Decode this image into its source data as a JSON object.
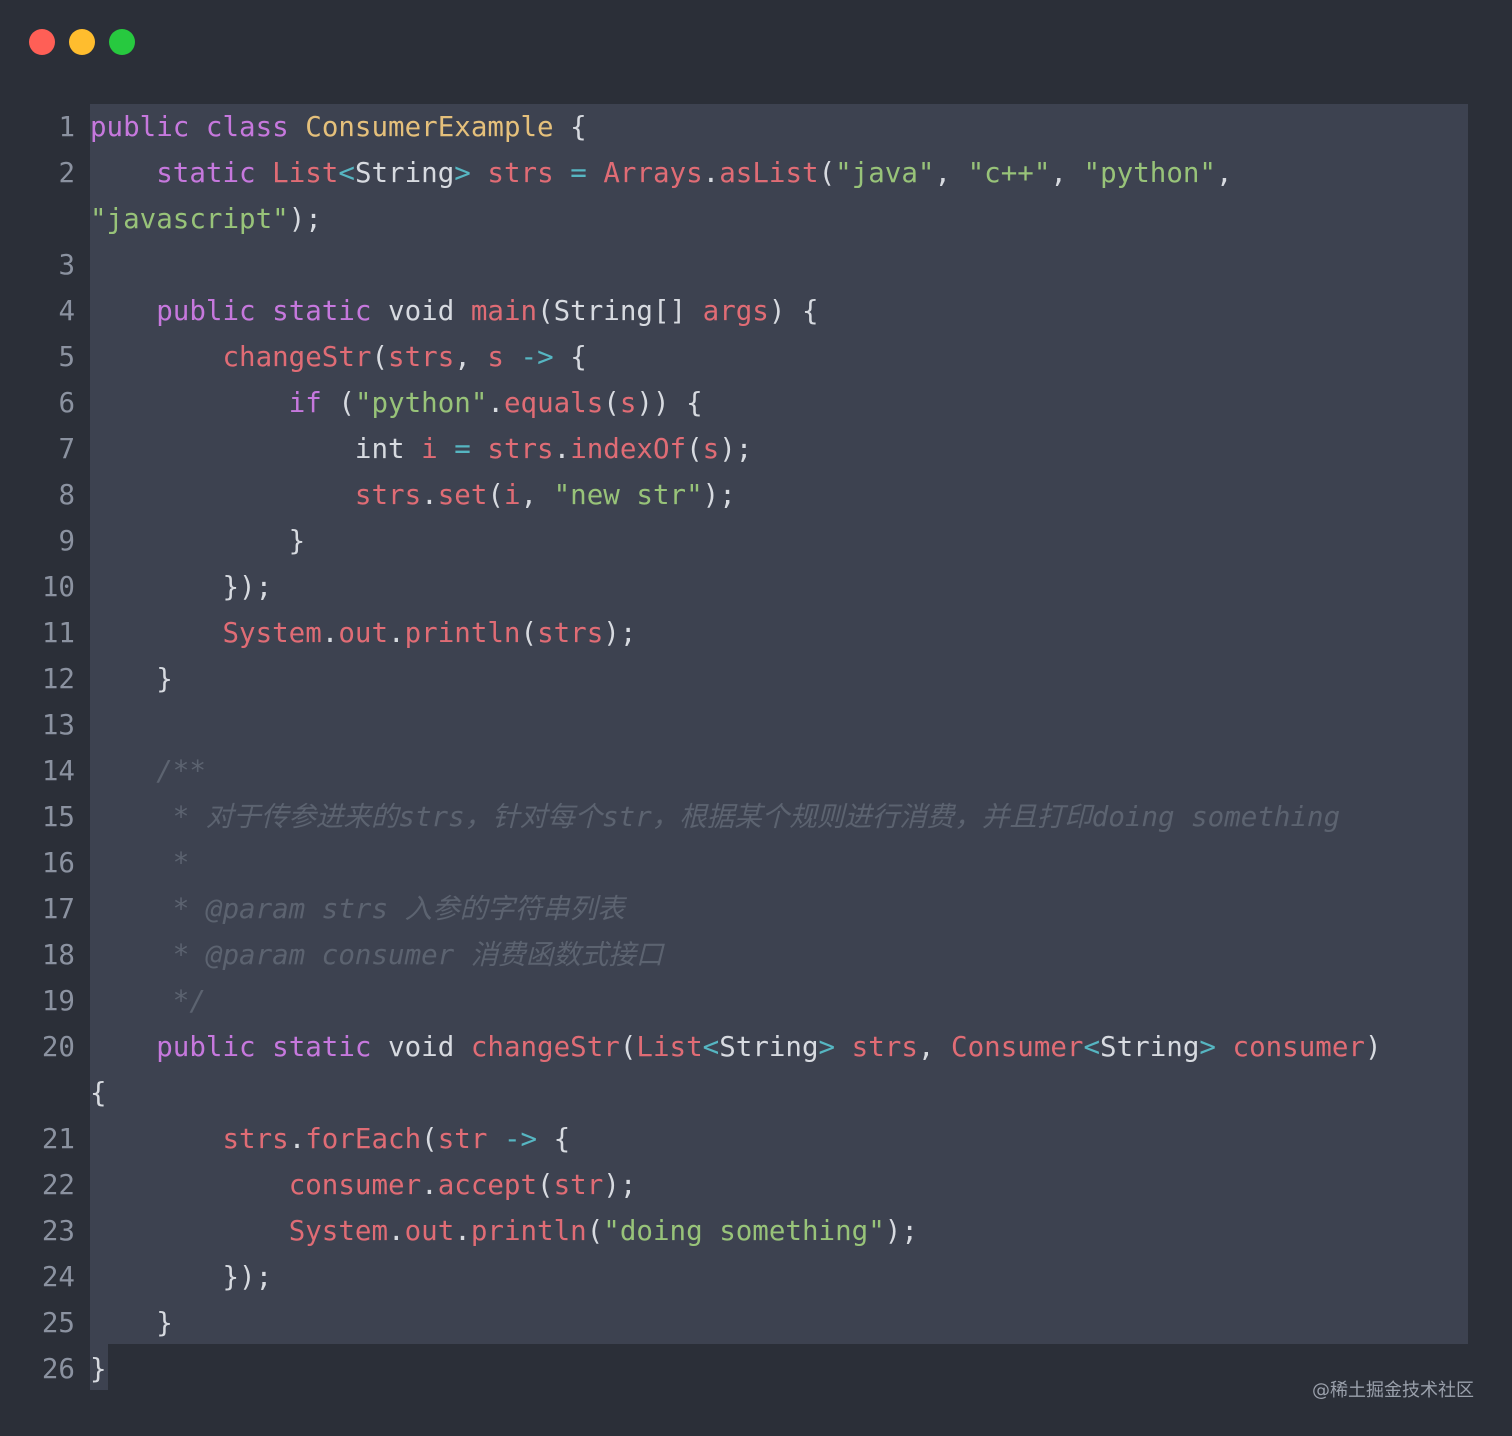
{
  "window": {
    "controls": [
      {
        "name": "close",
        "color": "#ff5f56"
      },
      {
        "name": "minimize",
        "color": "#ffbd2e"
      },
      {
        "name": "maximize",
        "color": "#27c93f"
      }
    ]
  },
  "code": {
    "lines": [
      {
        "n": "1",
        "t": [
          [
            "kw",
            "public"
          ],
          [
            "pl",
            " "
          ],
          [
            "kw",
            "class"
          ],
          [
            "pl",
            " "
          ],
          [
            "cls",
            "ConsumerExample"
          ],
          [
            "pl",
            " {"
          ]
        ]
      },
      {
        "n": "2",
        "t": [
          [
            "pl",
            "    "
          ],
          [
            "kw",
            "static"
          ],
          [
            "pl",
            " "
          ],
          [
            "typ",
            "List"
          ],
          [
            "op",
            "<"
          ],
          [
            "pl",
            "String"
          ],
          [
            "op",
            ">"
          ],
          [
            "pl",
            " "
          ],
          [
            "var",
            "strs"
          ],
          [
            "pl",
            " "
          ],
          [
            "op",
            "="
          ],
          [
            "pl",
            " "
          ],
          [
            "typ",
            "Arrays"
          ],
          [
            "pl",
            "."
          ],
          [
            "fn",
            "asList"
          ],
          [
            "pl",
            "("
          ],
          [
            "str",
            "\"java\""
          ],
          [
            "pl",
            ", "
          ],
          [
            "str",
            "\"c++\""
          ],
          [
            "pl",
            ", "
          ],
          [
            "str",
            "\"python\""
          ],
          [
            "pl",
            ","
          ]
        ]
      },
      {
        "n": "",
        "t": [
          [
            "str",
            "\"javascript\""
          ],
          [
            "pl",
            ");"
          ]
        ]
      },
      {
        "n": "3",
        "t": []
      },
      {
        "n": "4",
        "t": [
          [
            "pl",
            "    "
          ],
          [
            "kw",
            "public"
          ],
          [
            "pl",
            " "
          ],
          [
            "kw",
            "static"
          ],
          [
            "pl",
            " void "
          ],
          [
            "fn",
            "main"
          ],
          [
            "pl",
            "(String[] "
          ],
          [
            "var",
            "args"
          ],
          [
            "pl",
            ") {"
          ]
        ]
      },
      {
        "n": "5",
        "t": [
          [
            "pl",
            "        "
          ],
          [
            "fn",
            "changeStr"
          ],
          [
            "pl",
            "("
          ],
          [
            "var",
            "strs"
          ],
          [
            "pl",
            ", "
          ],
          [
            "var",
            "s"
          ],
          [
            "pl",
            " "
          ],
          [
            "op",
            "->"
          ],
          [
            "pl",
            " {"
          ]
        ]
      },
      {
        "n": "6",
        "t": [
          [
            "pl",
            "            "
          ],
          [
            "kw",
            "if"
          ],
          [
            "pl",
            " ("
          ],
          [
            "str",
            "\"python\""
          ],
          [
            "pl",
            "."
          ],
          [
            "fn",
            "equals"
          ],
          [
            "pl",
            "("
          ],
          [
            "var",
            "s"
          ],
          [
            "pl",
            ")) {"
          ]
        ]
      },
      {
        "n": "7",
        "t": [
          [
            "pl",
            "                int "
          ],
          [
            "var",
            "i"
          ],
          [
            "pl",
            " "
          ],
          [
            "op",
            "="
          ],
          [
            "pl",
            " "
          ],
          [
            "var",
            "strs"
          ],
          [
            "pl",
            "."
          ],
          [
            "fn",
            "indexOf"
          ],
          [
            "pl",
            "("
          ],
          [
            "var",
            "s"
          ],
          [
            "pl",
            ");"
          ]
        ]
      },
      {
        "n": "8",
        "t": [
          [
            "pl",
            "                "
          ],
          [
            "var",
            "strs"
          ],
          [
            "pl",
            "."
          ],
          [
            "fn",
            "set"
          ],
          [
            "pl",
            "("
          ],
          [
            "var",
            "i"
          ],
          [
            "pl",
            ", "
          ],
          [
            "str",
            "\"new str\""
          ],
          [
            "pl",
            ");"
          ]
        ]
      },
      {
        "n": "9",
        "t": [
          [
            "pl",
            "            }"
          ]
        ]
      },
      {
        "n": "10",
        "t": [
          [
            "pl",
            "        });"
          ]
        ]
      },
      {
        "n": "11",
        "t": [
          [
            "pl",
            "        "
          ],
          [
            "typ",
            "System"
          ],
          [
            "pl",
            "."
          ],
          [
            "var",
            "out"
          ],
          [
            "pl",
            "."
          ],
          [
            "fn",
            "println"
          ],
          [
            "pl",
            "("
          ],
          [
            "var",
            "strs"
          ],
          [
            "pl",
            ");"
          ]
        ]
      },
      {
        "n": "12",
        "t": [
          [
            "pl",
            "    }"
          ]
        ]
      },
      {
        "n": "13",
        "t": []
      },
      {
        "n": "14",
        "t": [
          [
            "cm",
            "    /**"
          ]
        ]
      },
      {
        "n": "15",
        "t": [
          [
            "cm",
            "     * 对于传参进来的strs，针对每个str，根据某个规则进行消费，并且打印doing something"
          ]
        ]
      },
      {
        "n": "16",
        "t": [
          [
            "cm",
            "     *"
          ]
        ]
      },
      {
        "n": "17",
        "t": [
          [
            "cm",
            "     * @param strs 入参的字符串列表"
          ]
        ]
      },
      {
        "n": "18",
        "t": [
          [
            "cm",
            "     * @param consumer 消费函数式接口"
          ]
        ]
      },
      {
        "n": "19",
        "t": [
          [
            "cm",
            "     */"
          ]
        ]
      },
      {
        "n": "20",
        "t": [
          [
            "pl",
            "    "
          ],
          [
            "kw",
            "public"
          ],
          [
            "pl",
            " "
          ],
          [
            "kw",
            "static"
          ],
          [
            "pl",
            " void "
          ],
          [
            "fn",
            "changeStr"
          ],
          [
            "pl",
            "("
          ],
          [
            "typ",
            "List"
          ],
          [
            "op",
            "<"
          ],
          [
            "pl",
            "String"
          ],
          [
            "op",
            ">"
          ],
          [
            "pl",
            " "
          ],
          [
            "var",
            "strs"
          ],
          [
            "pl",
            ", "
          ],
          [
            "typ",
            "Consumer"
          ],
          [
            "op",
            "<"
          ],
          [
            "pl",
            "String"
          ],
          [
            "op",
            ">"
          ],
          [
            "pl",
            " "
          ],
          [
            "var",
            "consumer"
          ],
          [
            "pl",
            ")"
          ]
        ]
      },
      {
        "n": "",
        "t": [
          [
            "pl",
            "{"
          ]
        ]
      },
      {
        "n": "21",
        "t": [
          [
            "pl",
            "        "
          ],
          [
            "var",
            "strs"
          ],
          [
            "pl",
            "."
          ],
          [
            "fn",
            "forEach"
          ],
          [
            "pl",
            "("
          ],
          [
            "var",
            "str"
          ],
          [
            "pl",
            " "
          ],
          [
            "op",
            "->"
          ],
          [
            "pl",
            " {"
          ]
        ]
      },
      {
        "n": "22",
        "t": [
          [
            "pl",
            "            "
          ],
          [
            "var",
            "consumer"
          ],
          [
            "pl",
            "."
          ],
          [
            "fn",
            "accept"
          ],
          [
            "pl",
            "("
          ],
          [
            "var",
            "str"
          ],
          [
            "pl",
            ");"
          ]
        ]
      },
      {
        "n": "23",
        "t": [
          [
            "pl",
            "            "
          ],
          [
            "typ",
            "System"
          ],
          [
            "pl",
            "."
          ],
          [
            "var",
            "out"
          ],
          [
            "pl",
            "."
          ],
          [
            "fn",
            "println"
          ],
          [
            "pl",
            "("
          ],
          [
            "str",
            "\"doing something\""
          ],
          [
            "pl",
            ");"
          ]
        ]
      },
      {
        "n": "24",
        "t": [
          [
            "pl",
            "        });"
          ]
        ]
      },
      {
        "n": "25",
        "t": [
          [
            "pl",
            "    }"
          ]
        ]
      },
      {
        "n": "26",
        "t": [
          [
            "pl",
            "}"
          ]
        ]
      }
    ]
  },
  "watermark": "@稀土掘金技术社区"
}
